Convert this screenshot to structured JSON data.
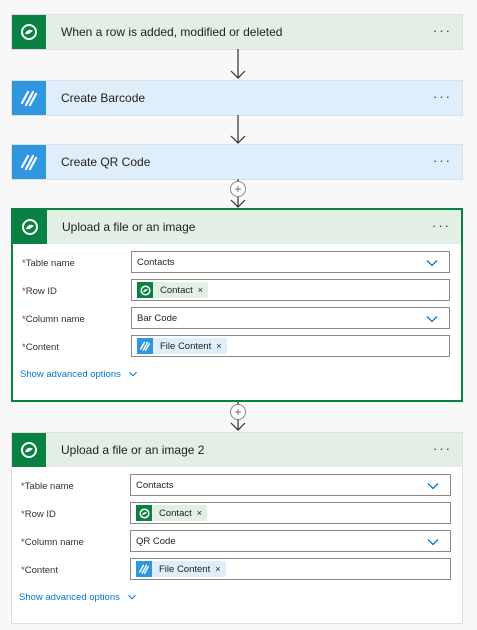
{
  "steps": [
    {
      "title": "When a row is added, modified or deleted",
      "icon": "dataverse-icon",
      "more": "···"
    },
    {
      "title": "Create Barcode",
      "icon": "barcode-connector-icon",
      "more": "···"
    },
    {
      "title": "Create QR Code",
      "icon": "barcode-connector-icon",
      "more": "···"
    },
    {
      "title": "Upload a file or an image",
      "icon": "dataverse-icon",
      "more": "···",
      "fields": {
        "table_label": "Table name",
        "table_value": "Contacts",
        "row_label": "Row ID",
        "row_token": "Contact",
        "column_label": "Column name",
        "column_value": "Bar Code",
        "content_label": "Content",
        "content_token": "File Content"
      },
      "advanced": "Show advanced options"
    },
    {
      "title": "Upload a file or an image 2",
      "icon": "dataverse-icon",
      "more": "···",
      "fields": {
        "table_label": "Table name",
        "table_value": "Contacts",
        "row_label": "Row ID",
        "row_token": "Contact",
        "column_label": "Column name",
        "column_value": "QR Code",
        "content_label": "Content",
        "content_token": "File Content"
      },
      "advanced": "Show advanced options"
    }
  ],
  "required_mark": "*",
  "token_remove": "×",
  "add_step": "+",
  "colors": {
    "dataverse": "#088142",
    "barcode": "#2f96e0",
    "link": "#0078d4",
    "required": "#a4262c"
  }
}
